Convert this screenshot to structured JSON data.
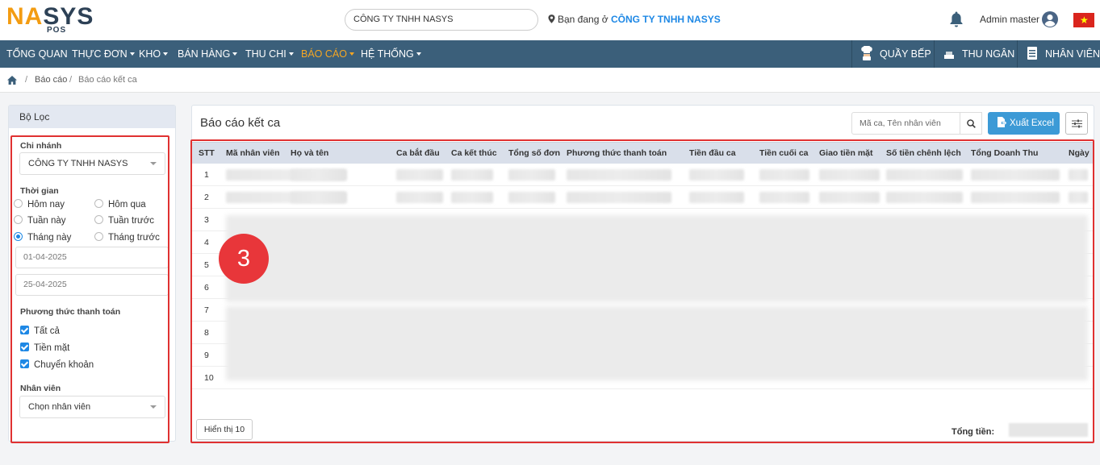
{
  "brand": {
    "logo_part1": "NA",
    "logo_part2": "SYS",
    "logo_sub": "POS"
  },
  "header": {
    "company_selector": "CÔNG TY TNHH NASYS",
    "location_prefix": "Bạn đang ở",
    "location_company": "CÔNG TY TNHH NASYS",
    "user_name": "Admin master"
  },
  "nav": {
    "items": [
      {
        "label": "TỔNG QUAN",
        "dropdown": false
      },
      {
        "label": "THỰC ĐƠN",
        "dropdown": true
      },
      {
        "label": "KHO",
        "dropdown": true
      },
      {
        "label": "BÁN HÀNG",
        "dropdown": true
      },
      {
        "label": "THU CHI",
        "dropdown": true
      },
      {
        "label": "BÁO CÁO",
        "dropdown": true,
        "active": true
      },
      {
        "label": "HỆ THỐNG",
        "dropdown": true
      }
    ],
    "right": [
      {
        "label": "QUẦY BẾP",
        "icon": "chef-icon"
      },
      {
        "label": "THU NGÂN",
        "icon": "cashier-icon"
      },
      {
        "label": "NHÂN VIÊN",
        "icon": "staff-icon"
      }
    ],
    "active_color": "#f5a623",
    "bar_color": "#3b5f7a"
  },
  "breadcrumb": {
    "sep": "/",
    "level1": "Báo cáo",
    "level2": "Báo cáo kết ca"
  },
  "filter": {
    "title": "Bộ Lọc",
    "branch_label": "Chi nhánh",
    "branch_value": "CÔNG TY TNHH NASYS",
    "time_label": "Thời gian",
    "time_options": [
      "Hôm nay",
      "Hôm qua",
      "Tuần này",
      "Tuần trước",
      "Tháng này",
      "Tháng trước"
    ],
    "time_selected": "Tháng này",
    "date_from": "01-04-2025",
    "date_to": "25-04-2025",
    "payment_label": "Phương thức thanh toán",
    "payment_options": [
      "Tất cả",
      "Tiền mặt",
      "Chuyển khoản"
    ],
    "payment_checked": [
      true,
      true,
      true
    ],
    "staff_label": "Nhân viên",
    "staff_placeholder": "Chọn nhân viên"
  },
  "report": {
    "title": "Báo cáo kết ca",
    "search_placeholder": "Mã ca, Tên nhân viên",
    "export_label": "Xuất Excel",
    "columns": [
      "STT",
      "Mã nhân viên",
      "Họ và tên",
      "Ca bắt đầu",
      "Ca kết thúc",
      "Tổng số đơn",
      "Phương thức thanh toán",
      "Tiền đầu ca",
      "Tiền cuối ca",
      "Giao tiền mặt",
      "Số tiền chênh lệch",
      "Tổng Doanh Thu",
      "Ngày"
    ],
    "rows": [
      "1",
      "2",
      "3",
      "4",
      "5",
      "6",
      "7",
      "8",
      "9",
      "10"
    ],
    "page_size_label": "Hiển thị 10",
    "total_label": "Tổng tiền:",
    "accent_color": "#3c9ad6"
  },
  "annotation": {
    "number": "3",
    "color": "#e8363a"
  }
}
